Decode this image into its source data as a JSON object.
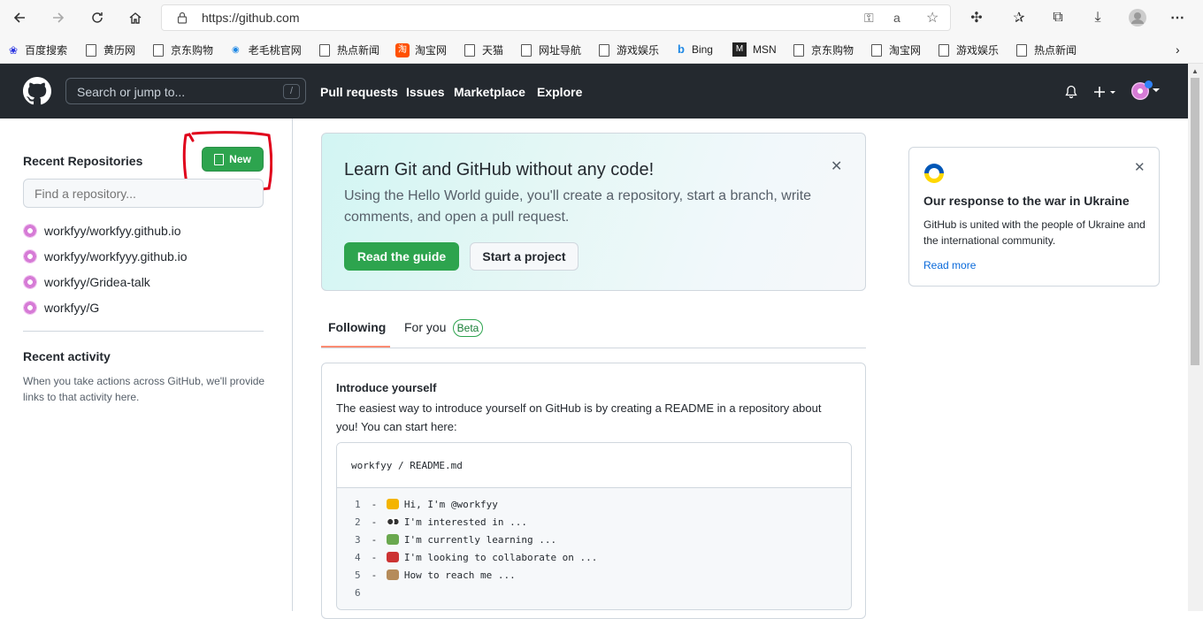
{
  "browser": {
    "url": "https://github.com",
    "bookmarks": [
      "百度搜索",
      "黄历网",
      "京东购物",
      "老毛桃官网",
      "热点新闻",
      "淘宝网",
      "天猫",
      "网址导航",
      "游戏娱乐",
      "Bing",
      "MSN",
      "京东购物",
      "淘宝网",
      "游戏娱乐",
      "热点新闻"
    ]
  },
  "header": {
    "search_placeholder": "Search or jump to...",
    "search_shortcut": "/",
    "nav": [
      "Pull requests",
      "Issues",
      "Marketplace",
      "Explore"
    ]
  },
  "sidebar": {
    "recent_title": "Recent Repositories",
    "new_label": "New",
    "find_placeholder": "Find a repository...",
    "repos": [
      "workfyy/workfyy.github.io",
      "workfyy/workfyyy.github.io",
      "workfyy/Gridea-talk",
      "workfyy/G"
    ],
    "activity_title": "Recent activity",
    "activity_text": "When you take actions across GitHub, we'll provide links to that activity here."
  },
  "banner": {
    "title": "Learn Git and GitHub without any code!",
    "text": "Using the Hello World guide, you'll create a repository, start a branch, write comments, and open a pull request.",
    "read_guide": "Read the guide",
    "start_project": "Start a project"
  },
  "tabs": {
    "following": "Following",
    "for_you": "For you",
    "beta": "Beta"
  },
  "intro": {
    "title": "Introduce yourself",
    "text": "The easiest way to introduce yourself on GitHub is by creating a README in a repository about you! You can start here:",
    "path_user": "workfyy",
    "path_sep": " / ",
    "path_file": "README.md",
    "lines": [
      {
        "n": "1",
        "pre": "- ",
        "text": "Hi, I'm @workfyy",
        "emoji_color": "#f4b400"
      },
      {
        "n": "2",
        "pre": "- ",
        "text": "I'm interested in ...",
        "emoji_color": "#333333"
      },
      {
        "n": "3",
        "pre": "- ",
        "text": "I'm currently learning ...",
        "emoji_color": "#6aa84f"
      },
      {
        "n": "4",
        "pre": "- ",
        "text": "I'm looking to collaborate on ...",
        "emoji_color": "#cc3333"
      },
      {
        "n": "5",
        "pre": "- ",
        "text": "How to reach me ...",
        "emoji_color": "#b58b5a"
      },
      {
        "n": "6",
        "pre": "",
        "text": "",
        "emoji_color": ""
      }
    ]
  },
  "ukraine": {
    "title": "Our response to the war in Ukraine",
    "text": "GitHub is united with the people of Ukraine and the international community.",
    "link": "Read more",
    "colors": {
      "blue": "#0057b7",
      "yellow": "#ffd700"
    }
  },
  "colors": {
    "accent_green": "#2da44e",
    "header_bg": "#24292f",
    "link_blue": "#0969da",
    "annotation_red": "#e0001b"
  }
}
